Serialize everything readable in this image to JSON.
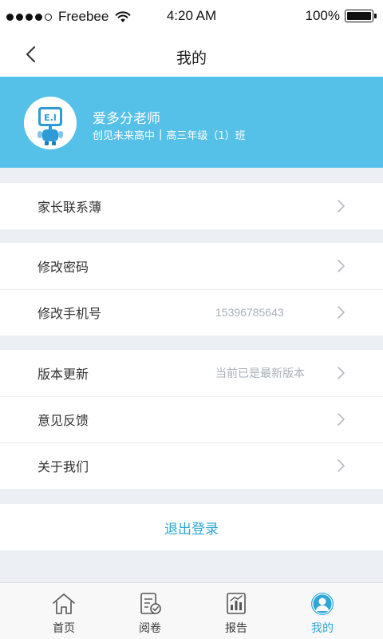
{
  "status_bar": {
    "carrier": "Freebee",
    "time": "4:20 AM",
    "battery": "100%",
    "battery_level": 1.0
  },
  "nav": {
    "title": "我的"
  },
  "profile": {
    "name": "爱多分老师",
    "school": "创见未来高中",
    "separator": "|",
    "class_name": "高三年级（1）班",
    "avatar_text": "E.I"
  },
  "menu": {
    "parents_book": "家长联系薄",
    "change_password": "修改密码",
    "change_phone": "修改手机号",
    "phone_value": "15396785643",
    "version_update": "版本更新",
    "version_value": "当前已是最新版本",
    "feedback": "意见反馈",
    "about": "关于我们"
  },
  "logout": "退出登录",
  "tabs": {
    "home": "首页",
    "review": "阅卷",
    "report": "报告",
    "mine": "我的"
  },
  "colors": {
    "accent": "#55c0e8",
    "active_tab": "#2ea6d6",
    "background": "#eceff4"
  }
}
